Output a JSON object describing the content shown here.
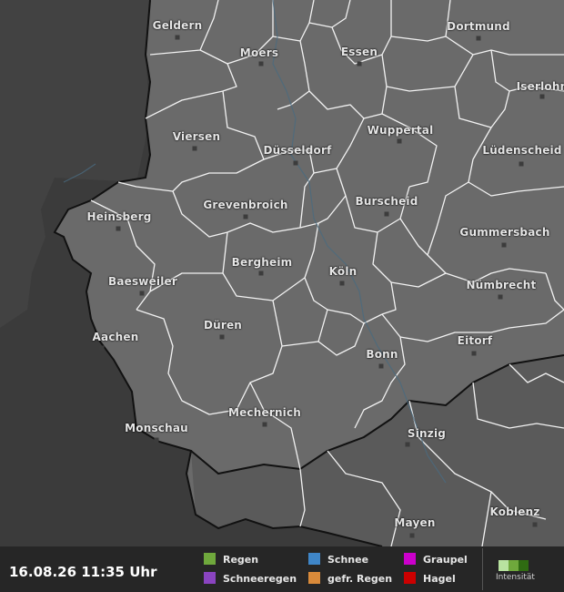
{
  "timestamp": "16.08.26 11:35 Uhr",
  "legend": [
    {
      "label": "Regen",
      "color": "#6fa83c"
    },
    {
      "label": "Schnee",
      "color": "#3f86c8"
    },
    {
      "label": "Graupel",
      "color": "#cc00cc"
    },
    {
      "label": "Schneeregen",
      "color": "#8a44c0"
    },
    {
      "label": "gefr. Regen",
      "color": "#d98a3a"
    },
    {
      "label": "Hagel",
      "color": "#cc0000"
    }
  ],
  "intensity": {
    "label": "Intensität",
    "colors": [
      "#b9e3a0",
      "#6fa83c",
      "#2f6b12"
    ]
  },
  "cities": [
    {
      "name": "Geldern"
    },
    {
      "name": "Moers"
    },
    {
      "name": "Essen"
    },
    {
      "name": "Dortmund"
    },
    {
      "name": "Iserlohn"
    },
    {
      "name": "Viersen"
    },
    {
      "name": "Düsseldorf"
    },
    {
      "name": "Wuppertal"
    },
    {
      "name": "Lüdenscheid"
    },
    {
      "name": "Grevenbroich"
    },
    {
      "name": "Burscheid"
    },
    {
      "name": "Heinsberg"
    },
    {
      "name": "Gummersbach"
    },
    {
      "name": "Bergheim"
    },
    {
      "name": "Köln"
    },
    {
      "name": "Baesweiler"
    },
    {
      "name": "Nümbrecht"
    },
    {
      "name": "Düren"
    },
    {
      "name": "Aachen"
    },
    {
      "name": "Eitorf"
    },
    {
      "name": "Bonn"
    },
    {
      "name": "Mechernich"
    },
    {
      "name": "Monschau"
    },
    {
      "name": "Sinzig"
    },
    {
      "name": "Mayen"
    },
    {
      "name": "Koblenz"
    }
  ]
}
